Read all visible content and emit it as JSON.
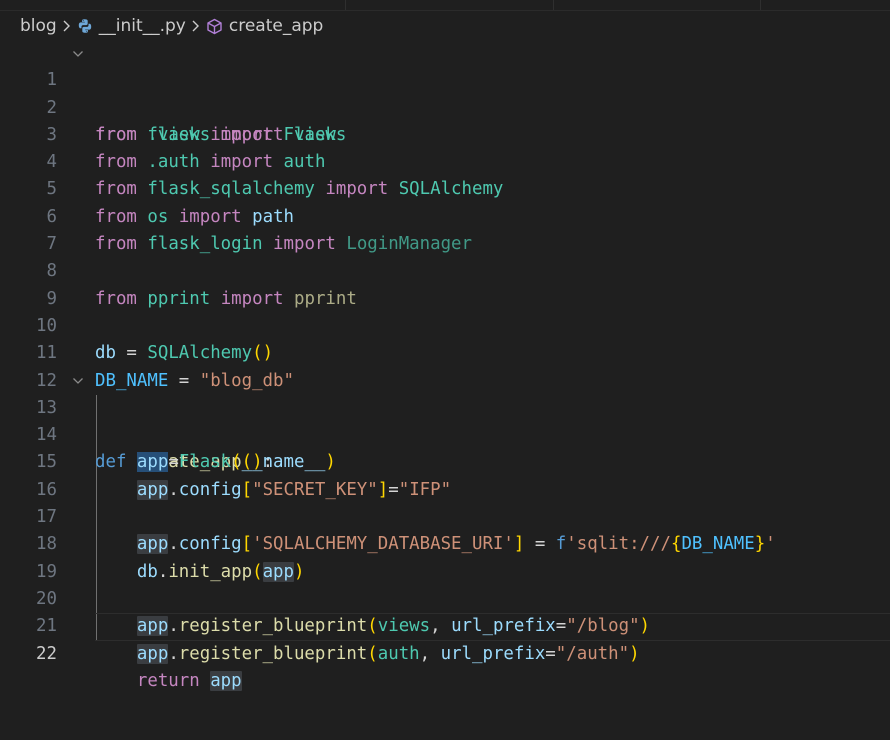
{
  "breadcrumb": {
    "folder": "blog",
    "file": "__init__.py",
    "symbol": "create_app"
  },
  "line_numbers": [
    "1",
    "2",
    "3",
    "4",
    "5",
    "6",
    "7",
    "8",
    "9",
    "10",
    "11",
    "12",
    "13",
    "14",
    "15",
    "16",
    "17",
    "18",
    "19",
    "20",
    "21",
    "22"
  ],
  "code": {
    "l1": {
      "kw1": "from",
      "mod": "flask",
      "kw2": "import",
      "name": "Flask"
    },
    "l2": {
      "kw1": "from",
      "mod": ".views",
      "kw2": "import",
      "name": "views"
    },
    "l3": {
      "kw1": "from",
      "mod": ".auth",
      "kw2": "import",
      "name": "auth"
    },
    "l4": {
      "kw1": "from",
      "mod": "flask_sqlalchemy",
      "kw2": "import",
      "name": "SQLAlchemy"
    },
    "l5": {
      "kw1": "from",
      "mod": "os",
      "kw2": "import",
      "name": "path"
    },
    "l6": {
      "kw1": "from",
      "mod": "flask_login",
      "kw2": "import",
      "name": "LoginManager"
    },
    "l8": {
      "kw1": "from",
      "mod": "pprint",
      "kw2": "import",
      "name": "pprint"
    },
    "l10": {
      "var": "db",
      "op": " = ",
      "fn": "SQLAlchemy",
      "open": "(",
      "close": ")"
    },
    "l11": {
      "const": "DB_NAME",
      "op": " = ",
      "str": "\"blog_db\""
    },
    "l13": {
      "kw": "def",
      "fn": "create_app",
      "open": "(",
      "close": ")",
      "colon": ":"
    },
    "l14": {
      "var": "app",
      "op": "=",
      "cls": "Flask",
      "open": "(",
      "arg": "__name__",
      "close": ")"
    },
    "l15": {
      "var": "app",
      "dot": ".",
      "attr": "config",
      "open": "[",
      "key": "\"SECRET_KEY\"",
      "close": "]",
      "op": "=",
      "val": "\"IFP\""
    },
    "l17": {
      "var": "app",
      "dot": ".",
      "attr": "config",
      "open": "[",
      "key": "'SQLALCHEMY_DATABASE_URI'",
      "close": "]",
      "op": " = ",
      "fprefix": "f",
      "fstr1": "'sqlit:///",
      "bopen": "{",
      "bvar": "DB_NAME",
      "bclose": "}",
      "fstr2": "'"
    },
    "l18": {
      "var": "db",
      "dot": ".",
      "fn": "init_app",
      "open": "(",
      "arg": "app",
      "close": ")"
    },
    "l20": {
      "var": "app",
      "dot": ".",
      "fn": "register_blueprint",
      "open": "(",
      "arg1": "views",
      "comma": ", ",
      "kwarg": "url_prefix",
      "eq": "=",
      "str": "\"/blog\"",
      "close": ")"
    },
    "l21": {
      "var": "app",
      "dot": ".",
      "fn": "register_blueprint",
      "open": "(",
      "arg1": "auth",
      "comma": ", ",
      "kwarg": "url_prefix",
      "eq": "=",
      "str": "\"/auth\"",
      "close": ")"
    },
    "l22": {
      "kw": "return",
      "var": "app"
    }
  },
  "colors": {
    "background": "#1f1f1f",
    "keyword_control": "#c586c0",
    "keyword_def": "#569cd6",
    "module": "#4ec9b0",
    "variable": "#9cdcfe",
    "constant": "#4fc1ff",
    "function": "#dcdcaa",
    "string": "#ce9178",
    "bracket": "#ffd700"
  },
  "icons": {
    "python_file": "python-icon",
    "symbol": "cube-icon",
    "fold": "chevron-down-icon",
    "separator": "chevron-right-icon"
  },
  "current_line": "22"
}
